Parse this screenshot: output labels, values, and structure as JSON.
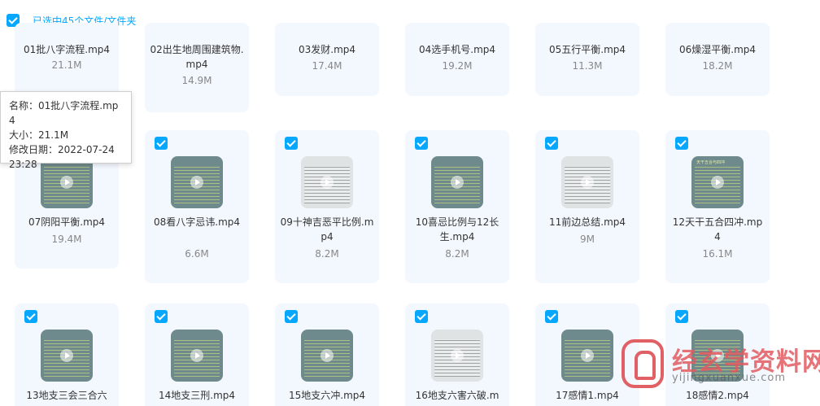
{
  "header": {
    "selection_text": "已选中45个文件/文件夹"
  },
  "tooltip": {
    "name_line": "名称：01批八字流程.mp4",
    "size_line": "大小：21.1M",
    "date_line": "修改日期：2022-07-24 23:28"
  },
  "files": [
    {
      "name": "01批八字流程.mp4",
      "size": "21.1M",
      "thumb_title": ""
    },
    {
      "name": "02出生地周围建筑物.mp4",
      "size": "14.9M",
      "thumb_title": ""
    },
    {
      "name": "03发财.mp4",
      "size": "17.4M",
      "thumb_title": ""
    },
    {
      "name": "04选手机号.mp4",
      "size": "19.2M",
      "thumb_title": ""
    },
    {
      "name": "05五行平衡.mp4",
      "size": "11.3M",
      "thumb_title": ""
    },
    {
      "name": "06燥湿平衡.mp4",
      "size": "18.2M",
      "thumb_title": ""
    },
    {
      "name": "07阴阳平衡.mp4",
      "size": "19.4M",
      "thumb_title": ""
    },
    {
      "name": "08看八字忌讳.mp4",
      "size": "6.6M",
      "thumb_title": ""
    },
    {
      "name": "09十神吉恶平比例.mp4",
      "size": "8.2M",
      "thumb_title": ""
    },
    {
      "name": "10喜忌比例与12长生.mp4",
      "size": "8.2M",
      "thumb_title": ""
    },
    {
      "name": "11前边总结.mp4",
      "size": "9M",
      "thumb_title": ""
    },
    {
      "name": "12天干五合四冲.mp4",
      "size": "16.1M",
      "thumb_title": "天干五合与四冲"
    },
    {
      "name": "13地支三会三合六",
      "size": "",
      "thumb_title": ""
    },
    {
      "name": "14地支三刑.mp4",
      "size": "",
      "thumb_title": ""
    },
    {
      "name": "15地支六冲.mp4",
      "size": "",
      "thumb_title": ""
    },
    {
      "name": "16地支六害六破.m",
      "size": "",
      "thumb_title": ""
    },
    {
      "name": "17感情1.mp4",
      "size": "",
      "thumb_title": ""
    },
    {
      "name": "18感情2.mp4",
      "size": "",
      "thumb_title": ""
    }
  ],
  "watermark": {
    "title": "经玄学资料网",
    "url": "yijingxuanxue.com"
  },
  "colors": {
    "accent": "#06a7ff",
    "tile_bg": "#f3f8fe",
    "watermark": "#e06065"
  }
}
